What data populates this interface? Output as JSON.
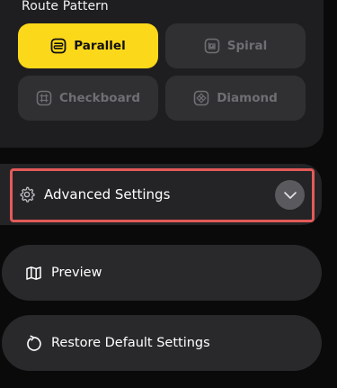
{
  "route_pattern": {
    "title": "Route Pattern",
    "options": [
      {
        "label": "Parallel",
        "icon": "parallel-icon",
        "selected": true
      },
      {
        "label": "Spiral",
        "icon": "spiral-icon",
        "selected": false
      },
      {
        "label": "Checkboard",
        "icon": "grid-icon",
        "selected": false
      },
      {
        "label": "Diamond",
        "icon": "diamond-icon",
        "selected": false
      }
    ]
  },
  "advanced": {
    "label": "Advanced Settings",
    "icon": "gear-icon",
    "expand_icon": "chevron-down-icon"
  },
  "actions": {
    "preview_label": "Preview",
    "preview_icon": "map-icon",
    "restore_label": "Restore Default Settings",
    "restore_icon": "restore-icon"
  },
  "colors": {
    "accent": "#fcd81b",
    "highlight": "#e35a59",
    "panel": "#1e1e20",
    "background": "#0a0a0a"
  }
}
